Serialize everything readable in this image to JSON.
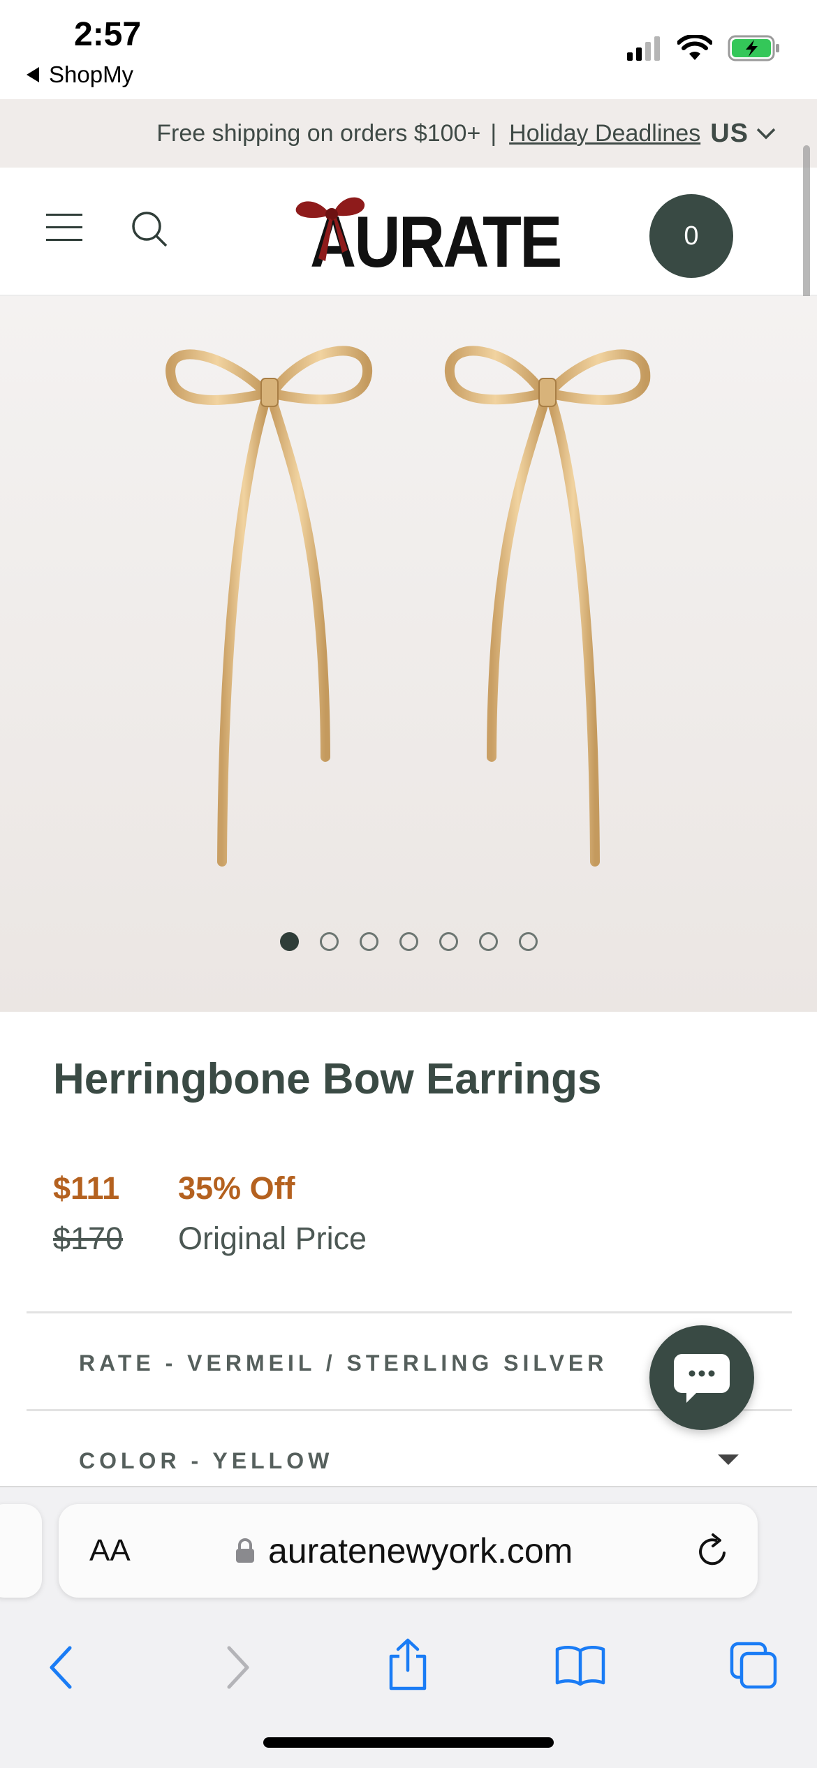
{
  "status_bar": {
    "time": "2:57",
    "back_app": "ShopMy"
  },
  "promo": {
    "text": "Free shipping on orders $100+",
    "separator": "|",
    "deadline_link": "Holiday Deadlines",
    "region": "US"
  },
  "header": {
    "logo": "AURATE",
    "cart_count": "0"
  },
  "gallery": {
    "image_count": 7,
    "active_index": 0
  },
  "product": {
    "title": "Herringbone Bow Earrings",
    "price": "$111",
    "discount": "35% Off",
    "original_price": "$170",
    "original_label": "Original Price"
  },
  "options": {
    "rate_label": "RATE - VERMEIL / STERLING SILVER",
    "color_label": "COLOR - YELLOW"
  },
  "browser": {
    "text_size_label": "AA",
    "url": "auratenewyork.com"
  },
  "icons": {
    "menu": "hamburger-menu-icon",
    "search": "search-icon",
    "chat": "chat-bubble-icon",
    "lock": "lock-icon",
    "reload": "reload-icon",
    "back": "chevron-left-icon",
    "forward": "chevron-right-icon",
    "share": "share-icon",
    "bookmarks": "book-icon",
    "tabs": "tabs-icon"
  },
  "colors": {
    "brand_dark": "#394a44",
    "price_accent": "#b4611f",
    "promo_bg": "#f0ecea",
    "safari_blue": "#1a7cf5"
  }
}
